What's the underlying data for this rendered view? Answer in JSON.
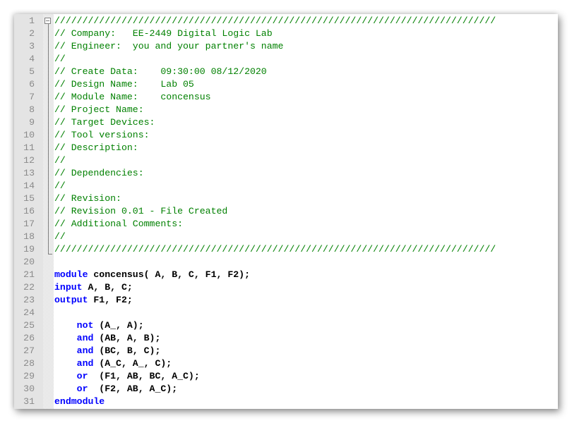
{
  "editor": {
    "language": "verilog",
    "colors": {
      "comment": "#008000",
      "keyword": "#0000ff",
      "identifier": "#000000",
      "line_number": "#8a8a8a",
      "gutter": "#e4e4e4"
    },
    "lines": [
      {
        "n": "1",
        "kind": "cm",
        "text": "///////////////////////////////////////////////////////////////////////////////"
      },
      {
        "n": "2",
        "kind": "cm",
        "text": "// Company:   EE-2449 Digital Logic Lab"
      },
      {
        "n": "3",
        "kind": "cm",
        "text": "// Engineer:  you and your partner's name"
      },
      {
        "n": "4",
        "kind": "cm",
        "text": "//"
      },
      {
        "n": "5",
        "kind": "cm",
        "text": "// Create Data:    09:30:00 08/12/2020"
      },
      {
        "n": "6",
        "kind": "cm",
        "text": "// Design Name:    Lab 05"
      },
      {
        "n": "7",
        "kind": "cm",
        "text": "// Module Name:    concensus"
      },
      {
        "n": "8",
        "kind": "cm",
        "text": "// Project Name:"
      },
      {
        "n": "9",
        "kind": "cm",
        "text": "// Target Devices:"
      },
      {
        "n": "10",
        "kind": "cm",
        "text": "// Tool versions:"
      },
      {
        "n": "11",
        "kind": "cm",
        "text": "// Description:"
      },
      {
        "n": "12",
        "kind": "cm",
        "text": "//"
      },
      {
        "n": "13",
        "kind": "cm",
        "text": "// Dependencies:"
      },
      {
        "n": "14",
        "kind": "cm",
        "text": "//"
      },
      {
        "n": "15",
        "kind": "cm",
        "text": "// Revision:"
      },
      {
        "n": "16",
        "kind": "cm",
        "text": "// Revision 0.01 - File Created"
      },
      {
        "n": "17",
        "kind": "cm",
        "text": "// Additional Comments:"
      },
      {
        "n": "18",
        "kind": "cm",
        "text": "//"
      },
      {
        "n": "19",
        "kind": "cm",
        "text": "///////////////////////////////////////////////////////////////////////////////"
      },
      {
        "n": "20",
        "kind": "blank",
        "text": ""
      },
      {
        "n": "21",
        "kind": "code",
        "kw": "module",
        "rest": " concensus( A, B, C, F1, F2);"
      },
      {
        "n": "22",
        "kind": "code",
        "kw": "input",
        "rest": " A, B, C;"
      },
      {
        "n": "23",
        "kind": "code",
        "kw": "output",
        "rest": " F1, F2;"
      },
      {
        "n": "24",
        "kind": "blank",
        "text": ""
      },
      {
        "n": "25",
        "kind": "code",
        "indent": "    ",
        "kw": "not",
        "rest": " (A_, A);"
      },
      {
        "n": "26",
        "kind": "code",
        "indent": "    ",
        "kw": "and",
        "rest": " (AB, A, B);"
      },
      {
        "n": "27",
        "kind": "code",
        "indent": "    ",
        "kw": "and",
        "rest": " (BC, B, C);"
      },
      {
        "n": "28",
        "kind": "code",
        "indent": "    ",
        "kw": "and",
        "rest": " (A_C, A_, C);"
      },
      {
        "n": "29",
        "kind": "code",
        "indent": "    ",
        "kw": "or",
        "rest": "  (F1, AB, BC, A_C);"
      },
      {
        "n": "30",
        "kind": "code",
        "indent": "    ",
        "kw": "or",
        "rest": "  (F2, AB, A_C);"
      },
      {
        "n": "31",
        "kind": "code",
        "kw": "endmodule",
        "rest": ""
      }
    ]
  }
}
